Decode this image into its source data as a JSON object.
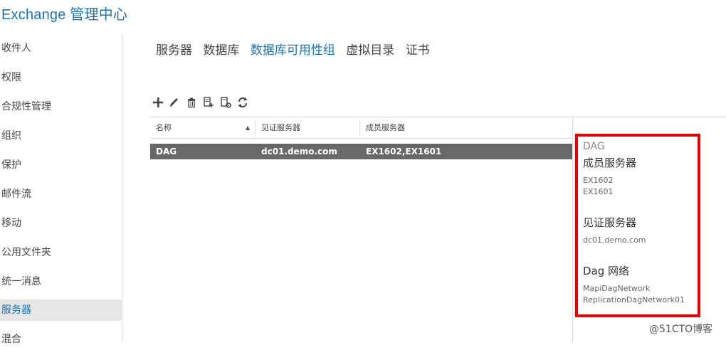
{
  "app": {
    "title": "Exchange 管理中心"
  },
  "sidebar": {
    "items": [
      {
        "label": "收件人"
      },
      {
        "label": "权限"
      },
      {
        "label": "合规性管理"
      },
      {
        "label": "组织"
      },
      {
        "label": "保护"
      },
      {
        "label": "邮件流"
      },
      {
        "label": "移动"
      },
      {
        "label": "公用文件夹"
      },
      {
        "label": "统一消息"
      },
      {
        "label": "服务器",
        "active": true
      },
      {
        "label": "混合"
      }
    ]
  },
  "tabs": [
    {
      "label": "服务器"
    },
    {
      "label": "数据库"
    },
    {
      "label": "数据库可用性组",
      "active": true
    },
    {
      "label": "虚拟目录"
    },
    {
      "label": "证书"
    }
  ],
  "toolbar": {
    "icons": [
      "add-icon",
      "edit-icon",
      "delete-icon",
      "add-member-icon",
      "configure-network-icon",
      "refresh-icon"
    ]
  },
  "table": {
    "columns": [
      "名称",
      "见证服务器",
      "成员服务器"
    ],
    "sort": {
      "column": "名称",
      "direction": "ascending"
    },
    "rows": [
      {
        "name": "DAG",
        "witness": "dc01.demo.com",
        "members": "EX1602,EX1601",
        "selected": true
      }
    ]
  },
  "details": {
    "title": "DAG",
    "members_heading": "成员服务器",
    "members": [
      "EX1602",
      "EX1601"
    ],
    "witness_heading": "见证服务器",
    "witness": "dc01.demo.com",
    "networks_heading": "Dag 网络",
    "networks": [
      "MapiDagNetwork",
      "ReplicationDagNetwork01"
    ]
  },
  "watermark": "@51CTO博客",
  "colors": {
    "accent": "#1a73b8",
    "selected_row": "#686868",
    "highlight_box": "#ee0000"
  }
}
